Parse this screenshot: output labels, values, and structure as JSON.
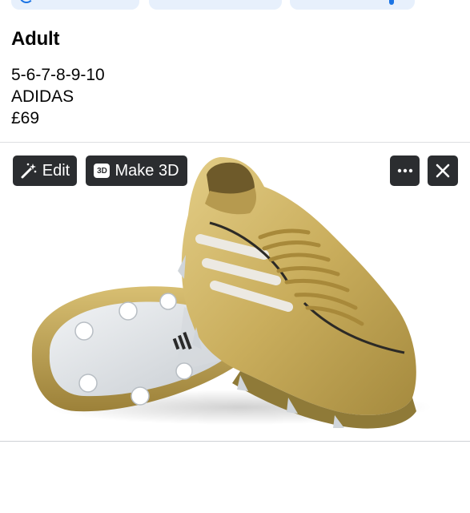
{
  "listing": {
    "title": "Adult",
    "sizes": "5-6-7-8-9-10",
    "brand": "ADIDAS",
    "price": "£69"
  },
  "media_toolbar": {
    "edit_label": "Edit",
    "make3d_label": "Make 3D",
    "make3d_badge": "3D",
    "more_icon": "more-horizontal-icon",
    "close_icon": "close-icon",
    "edit_icon": "magic-wand-icon"
  },
  "image": {
    "subject": "gold-football-boots",
    "colors": {
      "gold": "#c9ad5c",
      "gold_dark": "#8f7a38",
      "stripe": "#e8e6e0",
      "sole": "#dfe3e6"
    }
  },
  "colors": {
    "chip_bg": "#e7f0fc",
    "accent": "#1b74e4",
    "button_bg": "#2b2d30",
    "divider": "#dddfe2"
  }
}
